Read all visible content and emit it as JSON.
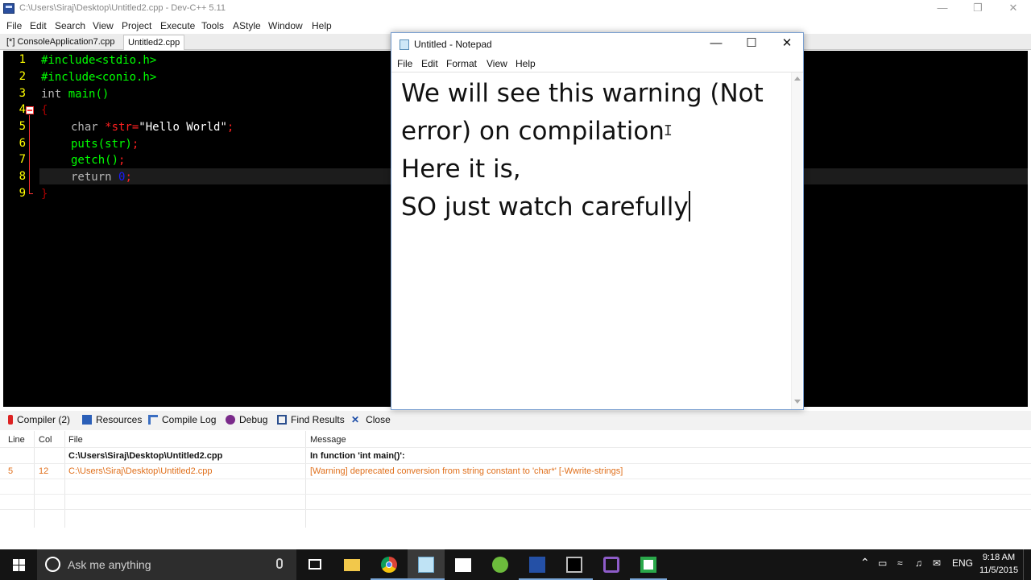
{
  "devcpp": {
    "title": "C:\\Users\\Siraj\\Desktop\\Untitled2.cpp - Dev-C++ 5.11",
    "menu": [
      "File",
      "Edit",
      "Search",
      "View",
      "Project",
      "Execute",
      "Tools",
      "AStyle",
      "Window",
      "Help"
    ],
    "tabs": [
      "[*] ConsoleApplication7.cpp",
      "Untitled2.cpp"
    ],
    "active_tab": "Untitled2.cpp",
    "line_numbers": [
      "1",
      "2",
      "3",
      "4",
      "5",
      "6",
      "7",
      "8",
      "9"
    ],
    "code": {
      "l1": "#include<stdio.h>",
      "l2": "#include<conio.h>",
      "l3_kw": "int",
      "l3_fn": " main()",
      "l4": "{",
      "l5_kw": "char",
      "l5_ptr": " *str=",
      "l5_str": "\"Hello World\"",
      "l5_end": ";",
      "l6_fn": "puts(str)",
      "l6_end": ";",
      "l7_fn": "getch()",
      "l7_end": ";",
      "l8_kw": "return",
      "l8_num": " 0",
      "l8_end": ";",
      "l9": "}"
    },
    "colors": {
      "editor_bg": "#000000",
      "line_number": "#ffff00",
      "code_green": "#00ff00",
      "code_red": "#ff2020",
      "warning_text": "#e0701c"
    }
  },
  "bottom_panel": {
    "tabs": [
      "Compiler (2)",
      "Resources",
      "Compile Log",
      "Debug",
      "Find Results",
      "Close"
    ],
    "columns": [
      "Line",
      "Col",
      "File",
      "Message"
    ],
    "rows": [
      {
        "line": "",
        "col": "",
        "file": "C:\\Users\\Siraj\\Desktop\\Untitled2.cpp",
        "message": "In function 'int main()':"
      },
      {
        "line": "5",
        "col": "12",
        "file": "C:\\Users\\Siraj\\Desktop\\Untitled2.cpp",
        "message": "[Warning] deprecated conversion from string constant to 'char*' [-Wwrite-strings]"
      }
    ]
  },
  "notepad": {
    "title": "Untitled - Notepad",
    "menu": [
      "File",
      "Edit",
      "Format",
      "View",
      "Help"
    ],
    "lines": [
      "We will see this warning (Not",
      "error) on compilation",
      "Here it is,",
      "SO just watch carefully"
    ]
  },
  "taskbar": {
    "search_placeholder": "Ask me anything",
    "apps": [
      "task-view-icon",
      "file-explorer-icon",
      "chrome-icon",
      "notepad-icon",
      "store-icon",
      "utorrent-icon",
      "devcpp-icon",
      "cmd-icon",
      "visual-studio-icon",
      "camtasia-icon"
    ],
    "language": "ENG",
    "time": "9:18 AM",
    "date": "11/5/2015"
  }
}
